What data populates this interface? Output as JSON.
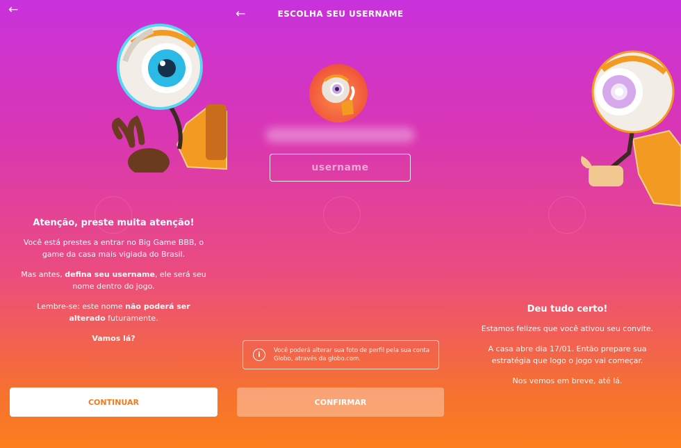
{
  "colors": {
    "accent_orange": "#f27a1c",
    "gradient_top": "#c832dc",
    "gradient_bottom": "#fb7f1e"
  },
  "panel_left": {
    "back_icon": "arrow-left-icon",
    "back_glyph": "←",
    "heading": "Atenção, preste muita atenção!",
    "para1": "Você está prestes a entrar no Big Game BBB, o game da casa mais vigiada do Brasil.",
    "para2": {
      "pre": "Mas antes, ",
      "bold": "defina seu username",
      "post": ", ele será seu nome dentro do jogo."
    },
    "para3": {
      "pre": "Lembre-se: este nome ",
      "bold": "não poderá ser alterado",
      "post": " futuramente."
    },
    "closing": "Vamos lá?",
    "button": "CONTINUAR"
  },
  "panel_center": {
    "back_icon": "arrow-left-icon",
    "back_glyph": "←",
    "title": "ESCOLHA SEU USERNAME",
    "username_placeholder": "username",
    "info_icon": "info-icon",
    "info_glyph": "i",
    "info_text": "Você poderá alterar sua foto de perfil pela sua conta Globo, através da globo.com.",
    "button": "CONFIRMAR"
  },
  "panel_right": {
    "heading": "Deu tudo certo!",
    "para1": "Estamos felizes que você ativou seu convite.",
    "para2": "A casa abre dia 17/01. Então prepare sua estratégia que logo o jogo vai começar.",
    "para3": "Nos vemos em breve, até lá."
  }
}
